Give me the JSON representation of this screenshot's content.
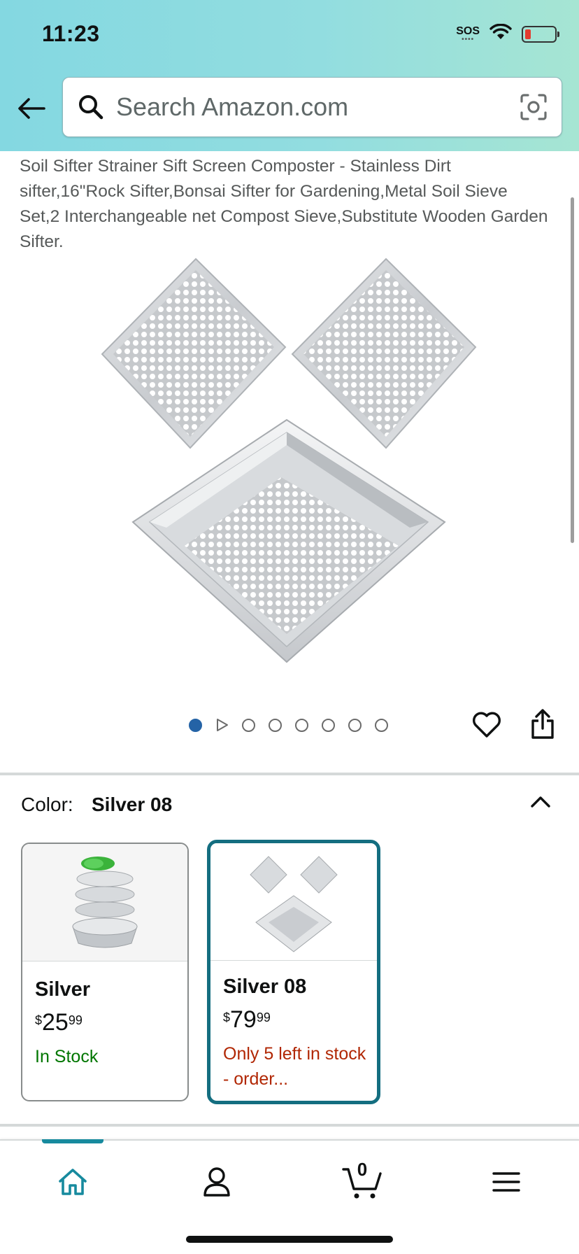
{
  "status_bar": {
    "time": "11:23",
    "sos": "SOS",
    "battery_level": 0.1
  },
  "header": {
    "search_placeholder": "Search Amazon.com"
  },
  "product": {
    "title": "Soil Sifter Strainer Sift Screen Composter - Stainless Dirt sifter,16\"Rock Sifter,Bonsai Sifter for Gardening,Metal Soil Sieve Set,2 Interchangeable net Compost Sieve,Substitute Wooden Garden Sifter.",
    "image_count": 8,
    "active_image": 1
  },
  "color": {
    "label": "Color:",
    "selected": "Silver 08",
    "options": [
      {
        "name": "Silver",
        "price_symbol": "$",
        "price_whole": "25",
        "price_fraction": "99",
        "stock": "In Stock"
      },
      {
        "name": "Silver 08",
        "price_symbol": "$",
        "price_whole": "79",
        "price_fraction": "99",
        "stock": "Only 5 left in stock - order..."
      }
    ]
  },
  "nav": {
    "cart_count": "0"
  },
  "colors": {
    "accent": "#146e80",
    "in_stock": "#007600",
    "low_stock": "#b12704",
    "active_dot": "#2463a6"
  }
}
